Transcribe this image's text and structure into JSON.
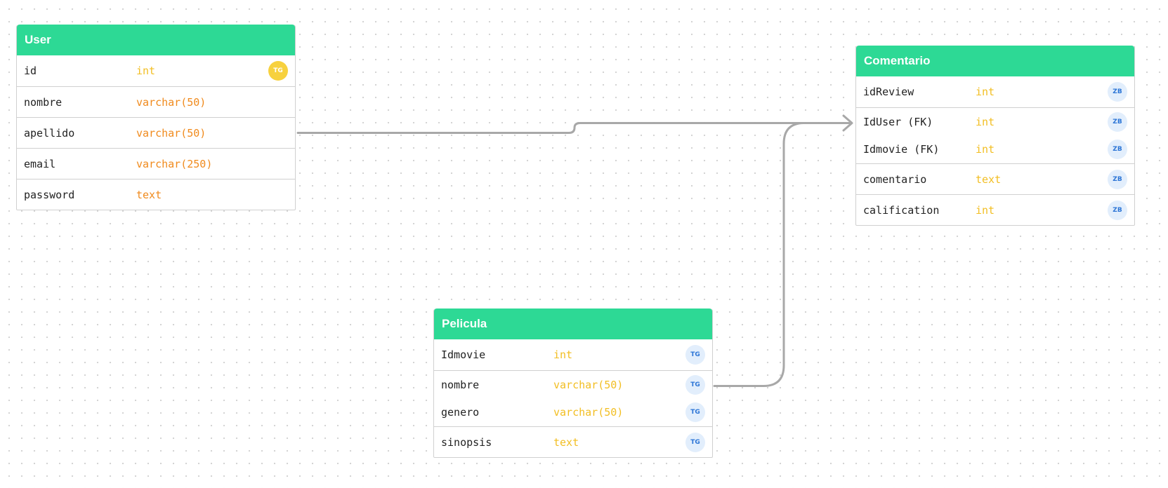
{
  "colors": {
    "header_bg": "#2dd995",
    "connector": "#a8a8a8",
    "type_yellow": "#f2be22",
    "type_orange": "#f08a1c",
    "badge_yellow": "#f7d13e",
    "badge_blue_bg": "#e2eefc",
    "badge_blue_text": "#2c75d6"
  },
  "tables": {
    "user": {
      "title": "User",
      "fields": [
        {
          "name": "id",
          "type": "int",
          "badge": "TG"
        },
        {
          "name": "nombre",
          "type": "varchar(50)"
        },
        {
          "name": "apellido",
          "type": "varchar(50)"
        },
        {
          "name": "email",
          "type": "varchar(250)"
        },
        {
          "name": "password",
          "type": "text"
        }
      ]
    },
    "comentario": {
      "title": "Comentario",
      "fields": [
        {
          "name": "idReview",
          "type": "int",
          "badge": "ZB"
        },
        {
          "name": "IdUser (FK)",
          "type": "int",
          "badge": "ZB"
        },
        {
          "name": "Idmovie (FK)",
          "type": "int",
          "badge": "ZB"
        },
        {
          "name": "comentario",
          "type": "text",
          "badge": "ZB"
        },
        {
          "name": "calification",
          "type": "int",
          "badge": "ZB"
        }
      ]
    },
    "pelicula": {
      "title": "Pelicula",
      "fields": [
        {
          "name": "Idmovie",
          "type": "int",
          "badge": "TG"
        },
        {
          "name": "nombre",
          "type": "varchar(50)",
          "badge": "TG"
        },
        {
          "name": "genero",
          "type": "varchar(50)",
          "badge": "TG"
        },
        {
          "name": "sinopsis",
          "type": "text",
          "badge": "TG"
        }
      ]
    }
  }
}
